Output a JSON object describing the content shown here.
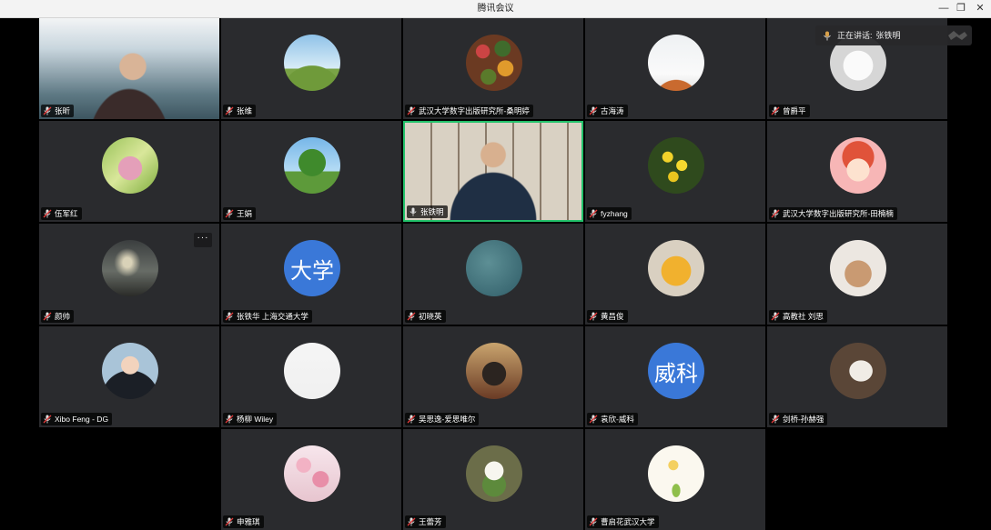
{
  "window": {
    "title": "腾讯会议",
    "minimize_icon": "minimize-icon",
    "restore_icon": "restore-icon",
    "close_icon": "close-icon"
  },
  "speaking_banner": {
    "label": "正在讲话:",
    "name": "张铁明"
  },
  "participants": [
    {
      "name": "张昕",
      "avatar": "video-landscape-man",
      "muted": true
    },
    {
      "name": "张维",
      "avatar": "photo-cyclist",
      "muted": true
    },
    {
      "name": "武汉大学数字出版研究所-桑明婷",
      "avatar": "photo-autumn-leaves",
      "muted": true
    },
    {
      "name": "古海涛",
      "avatar": "photo-snow-tree",
      "muted": true
    },
    {
      "name": "曾爵平",
      "avatar": "photo-white-dog",
      "muted": true
    },
    {
      "name": "伍军红",
      "avatar": "photo-pink-girl",
      "muted": true
    },
    {
      "name": "王娟",
      "avatar": "photo-tree-sky",
      "muted": true
    },
    {
      "name": "张铁明",
      "avatar": "video-office-man",
      "muted": false,
      "speaking": true
    },
    {
      "name": "fyzhang",
      "avatar": "photo-yellow-flowers",
      "muted": true
    },
    {
      "name": "武汉大学数字出版研究所-田楠楠",
      "avatar": "cartoon-redhead-girl",
      "muted": true
    },
    {
      "name": "颜帅",
      "avatar": "photo-cloudy-sky",
      "muted": true,
      "more": "···"
    },
    {
      "name": "张铁华 上海交通大学",
      "avatar": "text",
      "avatar_text": "大学",
      "muted": true
    },
    {
      "name": "初晓英",
      "avatar": "photo-blue-texture",
      "muted": true
    },
    {
      "name": "黄昌俊",
      "avatar": "photo-tigger-toy",
      "muted": true
    },
    {
      "name": "高教社 刘思",
      "avatar": "photo-kitten",
      "muted": true
    },
    {
      "name": "Xibo Feng - DG",
      "avatar": "photo-man-suit",
      "muted": true
    },
    {
      "name": "杨柳 Wiley",
      "avatar": "sketch-drawing",
      "muted": true
    },
    {
      "name": "吴思逸-爱思唯尔",
      "avatar": "photo-woman-street",
      "muted": true
    },
    {
      "name": "袁欣-威科",
      "avatar": "text",
      "avatar_text": "威科",
      "muted": true
    },
    {
      "name": "剑桥-孙赫强",
      "avatar": "photo-cambridge-bag",
      "muted": true
    },
    {
      "name": "申雅琪",
      "avatar": "photo-pink-blossom",
      "muted": true
    },
    {
      "name": "王蕾芳",
      "avatar": "photo-white-orchid",
      "muted": true
    },
    {
      "name": "曹启花武汉大学",
      "avatar": "illustration-girl-flower",
      "muted": true
    }
  ],
  "colors": {
    "tile": "#2a2b2e",
    "speaking_border": "#23c26b",
    "text_avatar": "#3a78d8",
    "muted_icon": "#e0e0e0"
  }
}
